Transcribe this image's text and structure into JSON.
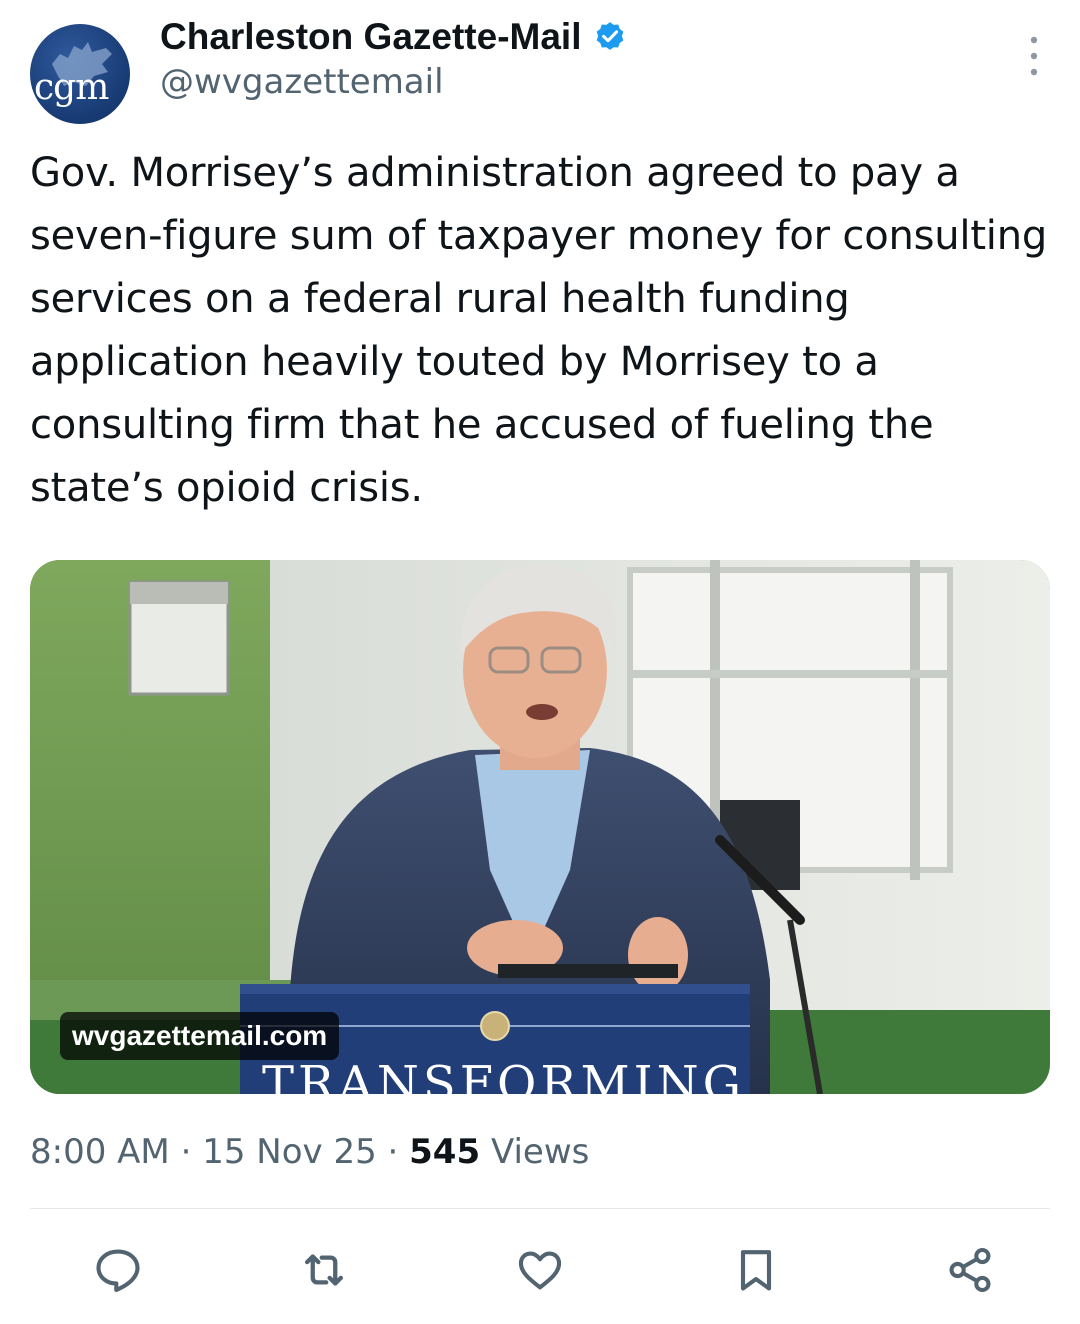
{
  "account": {
    "avatar_text": "cgm",
    "display_name": "Charleston Gazette-Mail",
    "handle": "@wvgazettemail",
    "verified": true
  },
  "tweet": {
    "text": "Gov. Morrisey’s administration agreed to pay a seven-figure sum of taxpayer money for consulting services on a federal rural health funding application heavily touted by Morrisey to a consulting firm that he accused of fueling the state’s opioid crisis."
  },
  "media": {
    "domain_label": "wvgazettemail.com",
    "podium_text": "TRANSFORMING"
  },
  "meta": {
    "time": "8:00 AM",
    "separator": " · ",
    "date": "15 Nov 25",
    "views_count": "545",
    "views_label": "Views"
  },
  "actions": [
    {
      "name": "reply-icon"
    },
    {
      "name": "retweet-icon"
    },
    {
      "name": "like-icon"
    },
    {
      "name": "bookmark-icon"
    },
    {
      "name": "share-icon"
    }
  ],
  "colors": {
    "text": "#0f1419",
    "secondary": "#536471",
    "verified": "#1d9bf0",
    "divider": "#e3e7ea"
  }
}
